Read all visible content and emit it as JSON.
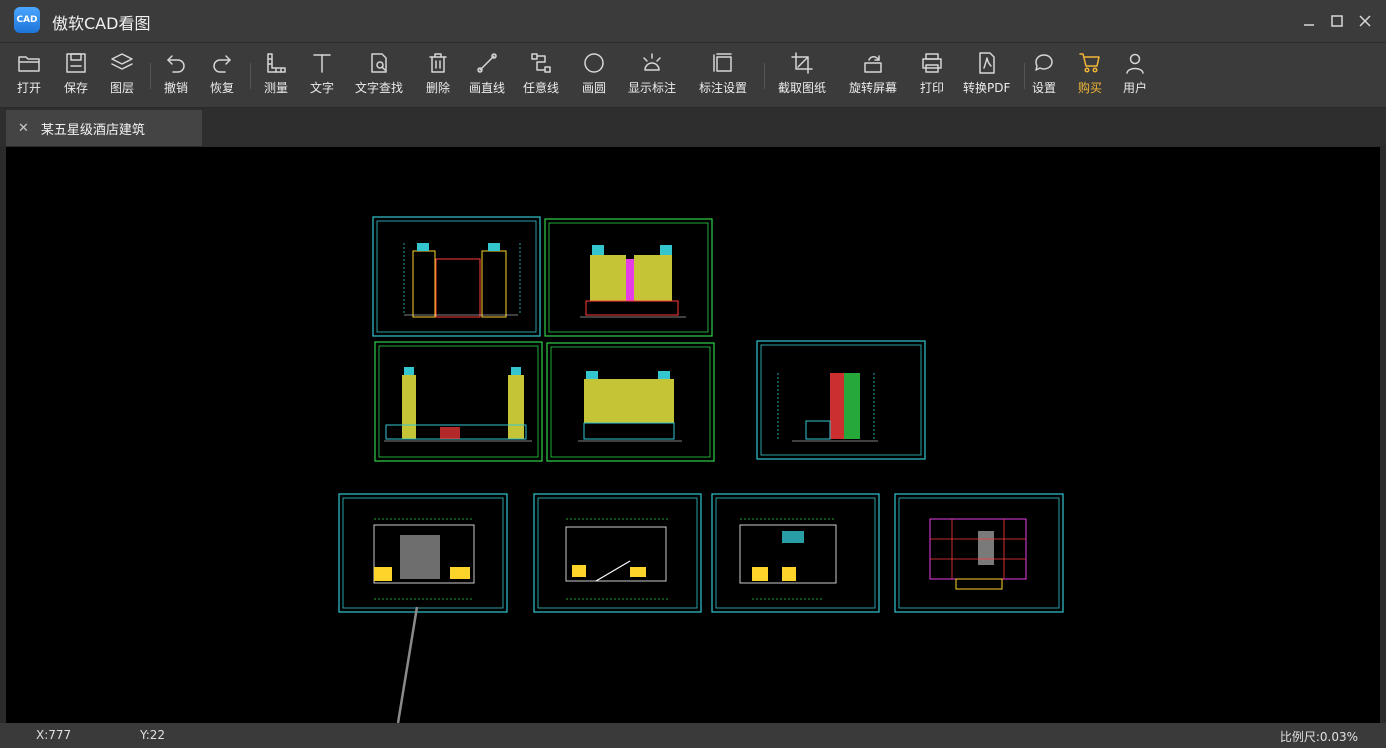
{
  "app": {
    "title": "傲软CAD看图",
    "logo_text": "CAD"
  },
  "toolbar": {
    "open": "打开",
    "save": "保存",
    "layers": "图层",
    "undo": "撤销",
    "redo": "恢复",
    "measure": "测量",
    "text": "文字",
    "text_find": "文字查找",
    "delete": "删除",
    "draw_line": "画直线",
    "free_line": "任意线",
    "draw_circle": "画圆",
    "show_marks": "显示标注",
    "mark_settings": "标注设置",
    "capture": "截取图纸",
    "rotate": "旋转屏幕",
    "print": "打印",
    "to_pdf": "转换PDF",
    "settings": "设置",
    "buy": "购买",
    "user": "用户"
  },
  "tabs": [
    {
      "label": "某五星级酒店建筑"
    }
  ],
  "status": {
    "x": "X:777",
    "y": "Y:22",
    "scale": "比例尺:0.03%"
  },
  "colors": {
    "accent": "#f2b637",
    "frame": "#33c6cf",
    "frame_green": "#2fd24a"
  }
}
